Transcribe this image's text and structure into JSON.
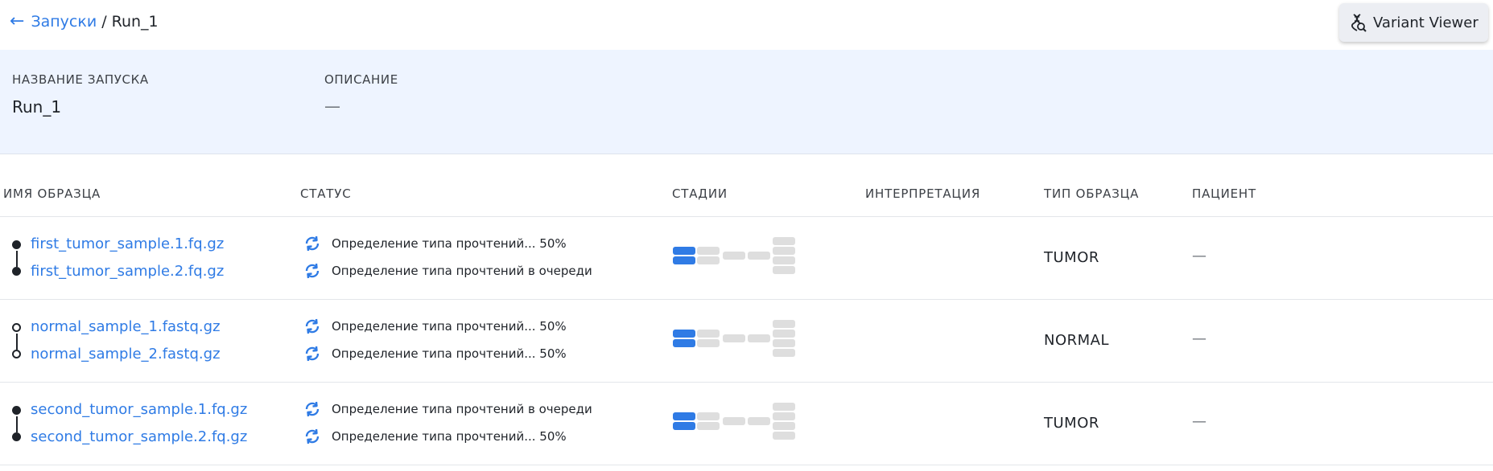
{
  "header": {
    "back_link": "Запуски",
    "separator": "/",
    "current": "Run_1",
    "variant_viewer_button": "Variant Viewer"
  },
  "run": {
    "name_label": "НАЗВАНИЕ ЗАПУСКА",
    "name_value": "Run_1",
    "description_label": "ОПИСАНИЕ",
    "description_value": "—"
  },
  "table": {
    "headers": {
      "sample_name": "ИМЯ ОБРАЗЦА",
      "status": "СТАТУС",
      "stages": "СТАДИИ",
      "interpretation": "ИНТЕРПРЕТАЦИЯ",
      "sample_type": "ТИП ОБРАЗЦА",
      "patient": "ПАЦИЕНТ"
    },
    "rows": [
      {
        "marker": "filled",
        "files": [
          "first_tumor_sample.1.fq.gz",
          "first_tumor_sample.2.fq.gz"
        ],
        "statuses": [
          "Определение типа прочтений... 50%",
          "Определение типа прочтений в очереди"
        ],
        "interpretation": "",
        "sample_type": "TUMOR",
        "patient": "—"
      },
      {
        "marker": "hollow",
        "files": [
          "normal_sample_1.fastq.gz",
          "normal_sample_2.fastq.gz"
        ],
        "statuses": [
          "Определение типа прочтений... 50%",
          "Определение типа прочтений... 50%"
        ],
        "interpretation": "",
        "sample_type": "NORMAL",
        "patient": "—"
      },
      {
        "marker": "filled",
        "files": [
          "second_tumor_sample.1.fq.gz",
          "second_tumor_sample.2.fq.gz"
        ],
        "statuses": [
          "Определение типа прочтений в очереди",
          "Определение типа прочтений... 50%"
        ],
        "interpretation": "",
        "sample_type": "TUMOR",
        "patient": "—"
      }
    ]
  },
  "icons": {
    "back": "arrow-left-icon",
    "variant_viewer": "dna-search-icon",
    "status": "refresh-sync-icon"
  },
  "colors": {
    "accent": "#2f7be5",
    "panel_bg": "#eef4ff",
    "stage_done": "#2f7be5",
    "stage_pending": "#dedede"
  }
}
